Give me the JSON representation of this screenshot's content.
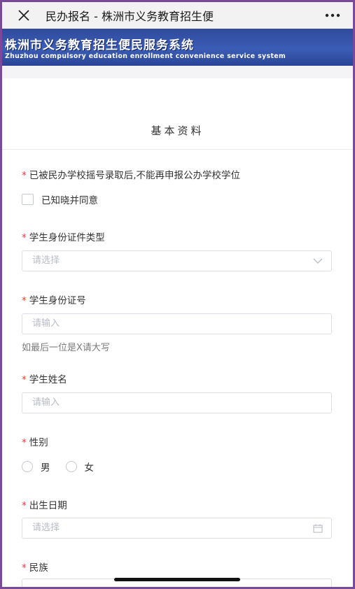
{
  "navbar": {
    "title": "民办报名 - 株洲市义务教育招生便",
    "close_icon": "close-icon",
    "more_icon": "more-icon"
  },
  "banner": {
    "title_cn": "株洲市义务教育招生便民服务系统",
    "title_en": "Zhuzhou compulsory education enrollment convenience service system"
  },
  "form": {
    "section_title": "基本资料",
    "notice": {
      "label": "已被民办学校摇号录取后,不能再申报公办学校学位",
      "checkbox_label": "已知晓并同意"
    },
    "id_type": {
      "label": "学生身份证件类型",
      "placeholder": "请选择"
    },
    "id_number": {
      "label": "学生身份证号",
      "placeholder": "请输入",
      "hint": "如最后一位是X请大写"
    },
    "name": {
      "label": "学生姓名",
      "placeholder": "请输入"
    },
    "gender": {
      "label": "性别",
      "options": [
        "男",
        "女"
      ]
    },
    "birthdate": {
      "label": "出生日期",
      "placeholder": "请选择"
    },
    "ethnicity": {
      "label": "民族"
    },
    "required_mark": "*"
  },
  "colors": {
    "required": "#e2453a",
    "banner": "#3b5db5",
    "frame_border": "#7a4a9a"
  }
}
